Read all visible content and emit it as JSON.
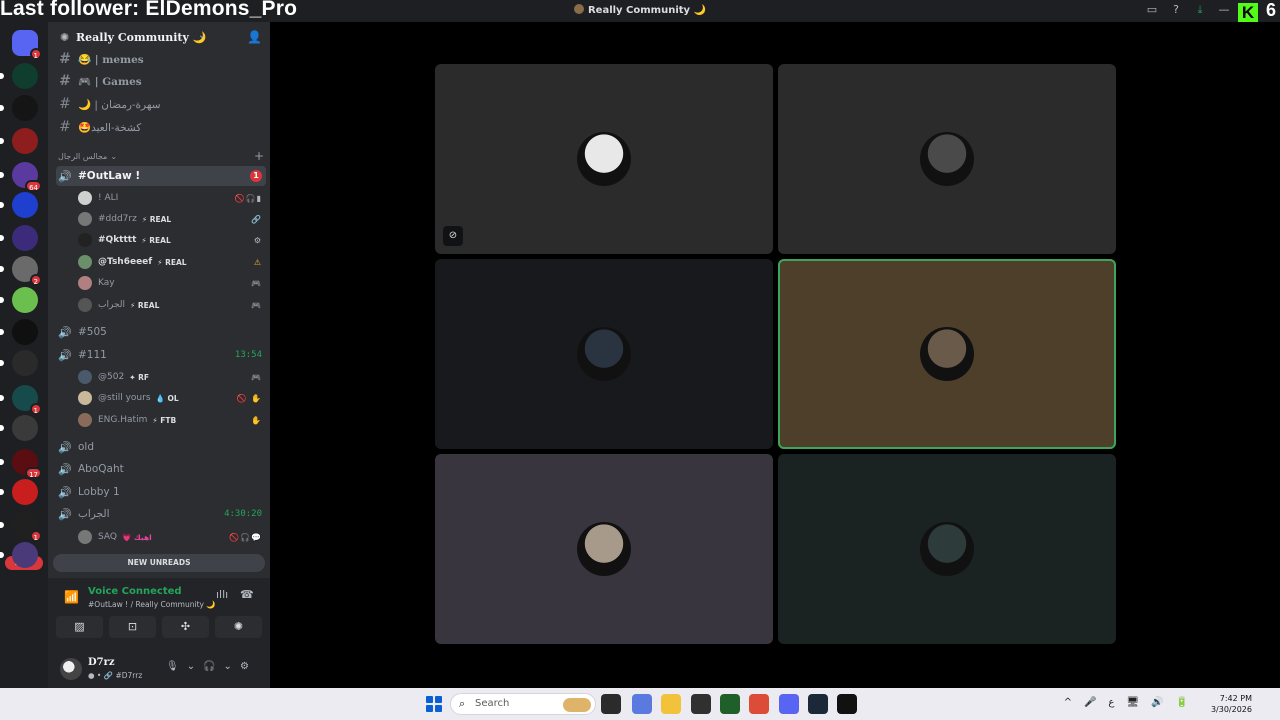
{
  "overlay": {
    "follower_text": "Last follower: ElDemons_Pro",
    "kick_logo": "K",
    "kick_count": "6"
  },
  "window": {
    "title": "Really Community 🌙"
  },
  "titlebar_icons": [
    "screen-share-icon",
    "help-icon",
    "download-icon",
    "minimize-icon"
  ],
  "rail": {
    "servers": [
      {
        "name": "direct-messages",
        "color": "#5865f2",
        "badge": "1"
      },
      {
        "name": "server-sw",
        "color": "#0f3d2e",
        "badge": ""
      },
      {
        "name": "server-dark",
        "color": "#151515",
        "badge": ""
      },
      {
        "name": "server-red-swirl",
        "color": "#8e1e1e",
        "badge": ""
      },
      {
        "name": "server-purple",
        "color": "#5b3aa0",
        "badge": "64"
      },
      {
        "name": "server-blue-diamond",
        "color": "#1f3fcf",
        "badge": ""
      },
      {
        "name": "server-dev",
        "color": "#3b2b7a",
        "badge": ""
      },
      {
        "name": "server-gray",
        "color": "#6a6a6a",
        "badge": "2"
      },
      {
        "name": "server-rainbow",
        "color": "#6bbf4f",
        "badge": ""
      },
      {
        "name": "server-black",
        "color": "#101010",
        "badge": ""
      },
      {
        "name": "server-f13",
        "color": "#2a2a2a",
        "badge": ""
      },
      {
        "name": "server-teal",
        "color": "#174a4a",
        "badge": "1"
      },
      {
        "name": "server-mono",
        "color": "#3a3a3a",
        "badge": ""
      },
      {
        "name": "server-crimson",
        "color": "#5a0e12",
        "badge": "17"
      },
      {
        "name": "server-red",
        "color": "#c81e1e",
        "badge": ""
      },
      {
        "name": "server-61",
        "color": "#202020",
        "badge": "1"
      },
      {
        "name": "server-violet",
        "color": "#4a3a7a",
        "badge": ""
      }
    ],
    "new_label": "NEW"
  },
  "sidebar": {
    "guild_name": "Really Community 🌙",
    "text_channels": [
      {
        "name": "😂 | memes"
      },
      {
        "name": "🎮 | Games"
      },
      {
        "name": "🌙 | سهرة-رمضان"
      },
      {
        "name": "🤩كشخة-العيد"
      }
    ],
    "category": "مجالس الرجال",
    "active_channel": {
      "name": "#OutLaw !",
      "unread": "1"
    },
    "outlaw_members": [
      {
        "name": "! ALI",
        "tag": "",
        "icons": "🚫🎧▮",
        "icon_class": "",
        "avatar": "#d0d0d0",
        "bold": false
      },
      {
        "name": "#ddd7rz",
        "tag": "⚡ REAL",
        "icons": "🔗",
        "icon_class": "",
        "avatar": "#777777",
        "bold": false
      },
      {
        "name": "#Qktttt",
        "tag": "⚡ REAL",
        "icons": "⚙",
        "icon_class": "",
        "avatar": "#222222",
        "bold": true
      },
      {
        "name": "@Tsh6eeef",
        "tag": "⚡ REAL",
        "icons": "⚠",
        "icon_class": "orange",
        "avatar": "#6a8f6a",
        "bold": true
      },
      {
        "name": "Kay",
        "tag": "",
        "icons": "🎮",
        "icon_class": "pink",
        "avatar": "#b08080",
        "bold": false
      },
      {
        "name": "الجراب",
        "tag": "⚡ REAL",
        "icons": "🎮",
        "icon_class": "pink",
        "avatar": "#555555",
        "bold": false
      }
    ],
    "voice_505": "#505",
    "voice_111": {
      "name": "#111",
      "time": "13:54"
    },
    "members_111": [
      {
        "name": "@502",
        "tag": "✦ RF",
        "icons": "🎮",
        "icon_class": "pink",
        "avatar": "#4a5a6a"
      },
      {
        "name": "@still yours",
        "tag": "💧 OL",
        "icons": "🚫 ✋",
        "icon_class": "orange",
        "avatar": "#c9b89a"
      },
      {
        "name": "ENG.Hatim",
        "tag": "⚡ FTB",
        "icons": "✋",
        "icon_class": "orange",
        "avatar": "#8a6b5a"
      }
    ],
    "voice_old": "old",
    "voice_aboqaht": "AboQaht",
    "voice_lobby": "Lobby 1",
    "voice_grab": {
      "name": "الجراب",
      "time": "4:30:20"
    },
    "grab_member": {
      "name": "SAQ",
      "tag": "💗 اهبك",
      "icons": "🚫🎧💬",
      "avatar": "#777777"
    },
    "new_unreads": "NEW UNREADS"
  },
  "voice_panel": {
    "title": "Voice Connected",
    "subtitle": "#OutLaw ! / Really Community 🌙",
    "buttons": [
      "camera-off-icon",
      "screen-share-icon",
      "activities-icon",
      "soundboard-icon"
    ],
    "button_glyphs": [
      "▨",
      "⊡",
      "✣",
      "✺"
    ]
  },
  "user": {
    "name": "D7rz",
    "status": "● • 🔗 #D7rrz"
  },
  "stage": {
    "tiles": [
      {
        "name": "tile-user-1",
        "bg": "#2b2b2b",
        "avatar": "#e8e8e8",
        "speaking": false,
        "muted": true
      },
      {
        "name": "tile-user-2",
        "bg": "#2b2b2b",
        "avatar": "#4a4a4a",
        "speaking": false,
        "muted": false
      },
      {
        "name": "tile-user-3",
        "bg": "#18191c",
        "avatar": "#2a3440",
        "speaking": false,
        "muted": false
      },
      {
        "name": "tile-user-4",
        "bg": "#4e3f2b",
        "avatar": "#6a5a4a",
        "speaking": true,
        "muted": false
      },
      {
        "name": "tile-user-5",
        "bg": "#38353f",
        "avatar": "#a89a8a",
        "speaking": false,
        "muted": false
      },
      {
        "name": "tile-user-6",
        "bg": "#1a2222",
        "avatar": "#2e3b3b",
        "speaking": false,
        "muted": false
      }
    ]
  },
  "taskbar": {
    "search_placeholder": "Search",
    "apps": [
      {
        "name": "task-view-icon",
        "color": "#2b2b2b"
      },
      {
        "name": "copilot-icon",
        "color": "#5a7ae0"
      },
      {
        "name": "file-explorer-icon",
        "color": "#f2c23a"
      },
      {
        "name": "obs-icon",
        "color": "#303030"
      },
      {
        "name": "terminal-icon",
        "color": "#1f5f2a"
      },
      {
        "name": "chrome-icon",
        "color": "#dd4b39"
      },
      {
        "name": "discord-icon",
        "color": "#5865f2"
      },
      {
        "name": "steam-icon",
        "color": "#1b2838"
      },
      {
        "name": "capcut-icon",
        "color": "#111111"
      }
    ],
    "tray": [
      "^",
      "🎤",
      "ع",
      "🖥",
      "🔊",
      "🔋"
    ],
    "time": "7:42 PM",
    "date": "3/30/2026"
  },
  "accent": {
    "green": "#23a55a",
    "red": "#da373c",
    "blurple": "#5865f2"
  }
}
